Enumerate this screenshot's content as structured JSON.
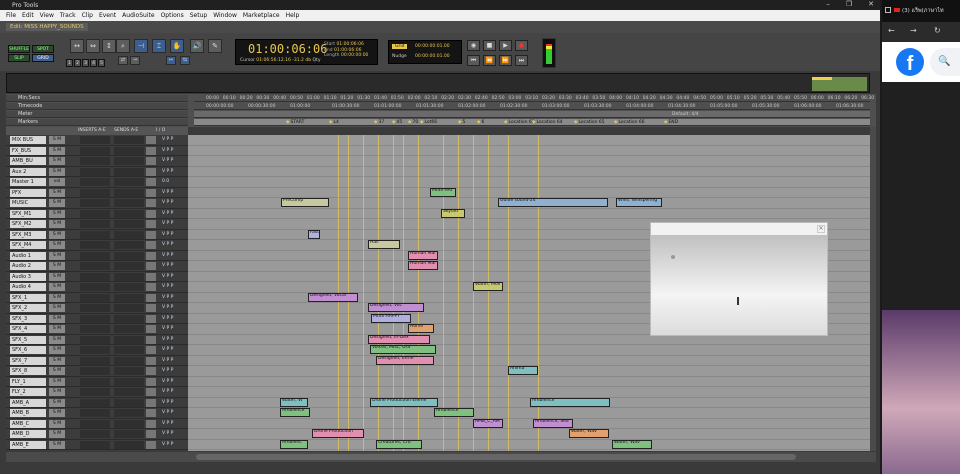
{
  "window": {
    "title": "Pro Tools",
    "controls": [
      "–",
      "❐",
      "✕"
    ]
  },
  "menu": [
    "File",
    "Edit",
    "View",
    "Track",
    "Clip",
    "Event",
    "AudioSuite",
    "Options",
    "Setup",
    "Window",
    "Marketplace",
    "Help"
  ],
  "edit_window_title": "Edit: MISS HAPPY_SOUNDS",
  "toolbar": {
    "modes": [
      "SHUFFLE",
      "SPOT",
      "SLIP",
      "GRID"
    ],
    "zoom_presets": [
      "1",
      "2",
      "3",
      "4",
      "5"
    ],
    "main_counter": "01:00:06:06",
    "start_label": "Start",
    "end_label": "End",
    "length_label": "Length",
    "start": "01:00:06:06",
    "end": "01:00:06:06",
    "length": "00:00:00:00",
    "cursor_label": "Cursor",
    "cursor_value": "01:06:56:12.16",
    "cursor_level": "-31.2 db",
    "qty": "Qty",
    "grid_label": "Grid",
    "grid_value": "00:00:00:01.00",
    "nudge_label": "Nudge",
    "nudge_value": "00:00:00:01.00"
  },
  "rulers": {
    "minsecs_label": "Min:Secs",
    "timecode_label": "Timecode",
    "meter_label": "Meter",
    "markers_label": "Markers",
    "meter_value": "Default: 4/4",
    "minsecs": [
      "00:00",
      "00:10",
      "00:20",
      "00:30",
      "00:40",
      "00:50",
      "01:00",
      "01:10",
      "01:20",
      "01:30",
      "01:40",
      "01:50",
      "02:00",
      "02:10",
      "02:20",
      "02:30",
      "02:40",
      "02:50",
      "03:00",
      "03:10",
      "03:20",
      "03:30",
      "03:40",
      "03:50",
      "04:00",
      "04:10",
      "04:20",
      "04:30",
      "04:40",
      "04:50",
      "05:00",
      "05:10",
      "05:20",
      "05:30",
      "05:40",
      "05:50",
      "06:00",
      "06:10",
      "06:20",
      "06:30"
    ],
    "timecode": [
      "00:00:00:00",
      "00:00:30:00",
      "01:00:00",
      "01:00:30:00",
      "01:01:00:00",
      "01:01:30:00",
      "01:02:00:00",
      "01:02:30:00",
      "01:03:00:00",
      "01:03:30:00",
      "01:04:00:00",
      "01:04:30:00",
      "01:05:00:00",
      "01:05:30:00",
      "01:06:00:00",
      "01:06:30:00"
    ],
    "markers": [
      "START",
      "L4",
      "37",
      "45",
      "70",
      "Lot66",
      "5",
      "6",
      "Location 63",
      "Location 64",
      "Location 65",
      "Location 66",
      "END"
    ]
  },
  "track_header": {
    "inserts": "INSERTS A-E",
    "sends": "SENDS A-E",
    "io": "I / O"
  },
  "tracks": [
    {
      "name": "MIX BUS",
      "sm": "S M",
      "vp": "V P P"
    },
    {
      "name": "FX_BUS",
      "sm": "S M",
      "vp": "V P P"
    },
    {
      "name": "AMB_BU",
      "sm": "S M",
      "vp": "V P P"
    },
    {
      "name": "Aux 2",
      "sm": "S M",
      "vp": "V P P"
    },
    {
      "name": "Master 1",
      "sm": "vol",
      "vp": "0.0"
    },
    {
      "name": "PFX",
      "sm": "S M",
      "vp": "V P P"
    },
    {
      "name": "MUSIC",
      "sm": "S M",
      "vp": "V P P"
    },
    {
      "name": "SFX_M1",
      "sm": "S M",
      "vp": "V P P"
    },
    {
      "name": "SFX_M2",
      "sm": "S M",
      "vp": "V P P"
    },
    {
      "name": "SFX_M3",
      "sm": "S M",
      "vp": "V P P"
    },
    {
      "name": "SFX_M4",
      "sm": "S M",
      "vp": "V P P"
    },
    {
      "name": "Audio 1",
      "sm": "S M",
      "vp": "V P P"
    },
    {
      "name": "Audio 2",
      "sm": "S M",
      "vp": "V P P"
    },
    {
      "name": "Audio 3",
      "sm": "S M",
      "vp": "V P P"
    },
    {
      "name": "Audio 4",
      "sm": "S M",
      "vp": "V P P"
    },
    {
      "name": "SFX_1",
      "sm": "S M",
      "vp": "V P P"
    },
    {
      "name": "SFX_2",
      "sm": "S M",
      "vp": "V P P"
    },
    {
      "name": "SFX_3",
      "sm": "S M",
      "vp": "V P P"
    },
    {
      "name": "SFX_4",
      "sm": "S M",
      "vp": "V P P"
    },
    {
      "name": "SFX_5",
      "sm": "S M",
      "vp": "V P P"
    },
    {
      "name": "SFX_6",
      "sm": "S M",
      "vp": "V P P"
    },
    {
      "name": "SFX_7",
      "sm": "S M",
      "vp": "V P P"
    },
    {
      "name": "SFX_8",
      "sm": "S M",
      "vp": "V P P"
    },
    {
      "name": "FLY_1",
      "sm": "S M",
      "vp": "V P P"
    },
    {
      "name": "FLY_2",
      "sm": "S M",
      "vp": "V P P"
    },
    {
      "name": "AMB_A",
      "sm": "S M",
      "vp": "V P P"
    },
    {
      "name": "AMB_B",
      "sm": "S M",
      "vp": "V P P"
    },
    {
      "name": "AMB_C",
      "sm": "S M",
      "vp": "V P P"
    },
    {
      "name": "AMB_D",
      "sm": "S M",
      "vp": "V P P"
    },
    {
      "name": "AMB_E",
      "sm": "S M",
      "vp": "V P P"
    }
  ],
  "clips": [
    {
      "lane": 5,
      "text": "MISS HAI",
      "color": "#7fbf7f"
    },
    {
      "lane": 6,
      "text": "PreComp",
      "color": "#c8c8a0"
    },
    {
      "lane": 6,
      "text": "Guide sound-24",
      "color": "#8fb0d0"
    },
    {
      "lane": 6,
      "text": "Whis. Whispering",
      "color": "#8fb0d0"
    },
    {
      "lane": 7,
      "text": "Skylad",
      "color": "#c8c870"
    },
    {
      "lane": 9,
      "text": "Fast",
      "color": "#b0b0e0"
    },
    {
      "lane": 10,
      "text": "Hail",
      "color": "#c8c8a0"
    },
    {
      "lane": 11,
      "text": "Human Mal",
      "color": "#e08fb0"
    },
    {
      "lane": 12,
      "text": "Human Mal",
      "color": "#e08fb0"
    },
    {
      "lane": 14,
      "text": "Water, Mov",
      "color": "#c8c870"
    },
    {
      "lane": 15,
      "text": "Designed, Vocal",
      "color": "#c08fd0"
    },
    {
      "lane": 16,
      "text": "Designed, Voc",
      "color": "#c08fd0"
    },
    {
      "lane": 17,
      "text": "MISS HAPPY",
      "color": "#b0b0e0"
    },
    {
      "lane": 18,
      "text": "Horse",
      "color": "#e0a070"
    },
    {
      "lane": 19,
      "text": "Designed, In-Dex",
      "color": "#e08fb0"
    },
    {
      "lane": 20,
      "text": "Voices, Misc, Ora",
      "color": "#7fbf7f"
    },
    {
      "lane": 21,
      "text": "Designed, Eerie",
      "color": "#e08fb0"
    },
    {
      "lane": 22,
      "text": "Anima",
      "color": "#7fbfbf"
    },
    {
      "lane": 25,
      "text": "Water, W",
      "color": "#7fbfbf"
    },
    {
      "lane": 25,
      "text": "Drone Production Eleme",
      "color": "#7fbfbf"
    },
    {
      "lane": 25,
      "text": "Ambience",
      "color": "#7fbfbf"
    },
    {
      "lane": 26,
      "text": "Ambience",
      "color": "#7fbf7f"
    },
    {
      "lane": 26,
      "text": "Ambience",
      "color": "#7fbf7f"
    },
    {
      "lane": 27,
      "text": "AMB_C_AM",
      "color": "#c08fd0"
    },
    {
      "lane": 27,
      "text": "Ambience, Sea",
      "color": "#c08fd0"
    },
    {
      "lane": 28,
      "text": "Drone Production",
      "color": "#e08fb0"
    },
    {
      "lane": 28,
      "text": "Water, Wav",
      "color": "#e0a070"
    },
    {
      "lane": 29,
      "text": "Ambienc",
      "color": "#7fbf7f"
    },
    {
      "lane": 29,
      "text": "Creatures, Cru",
      "color": "#7fbf7f"
    },
    {
      "lane": 29,
      "text": "Water, Wav",
      "color": "#7fbf7f"
    }
  ],
  "browser": {
    "tab_title": "(3) แร็พ(ภาษาไท",
    "search_glyph": "🔍"
  }
}
